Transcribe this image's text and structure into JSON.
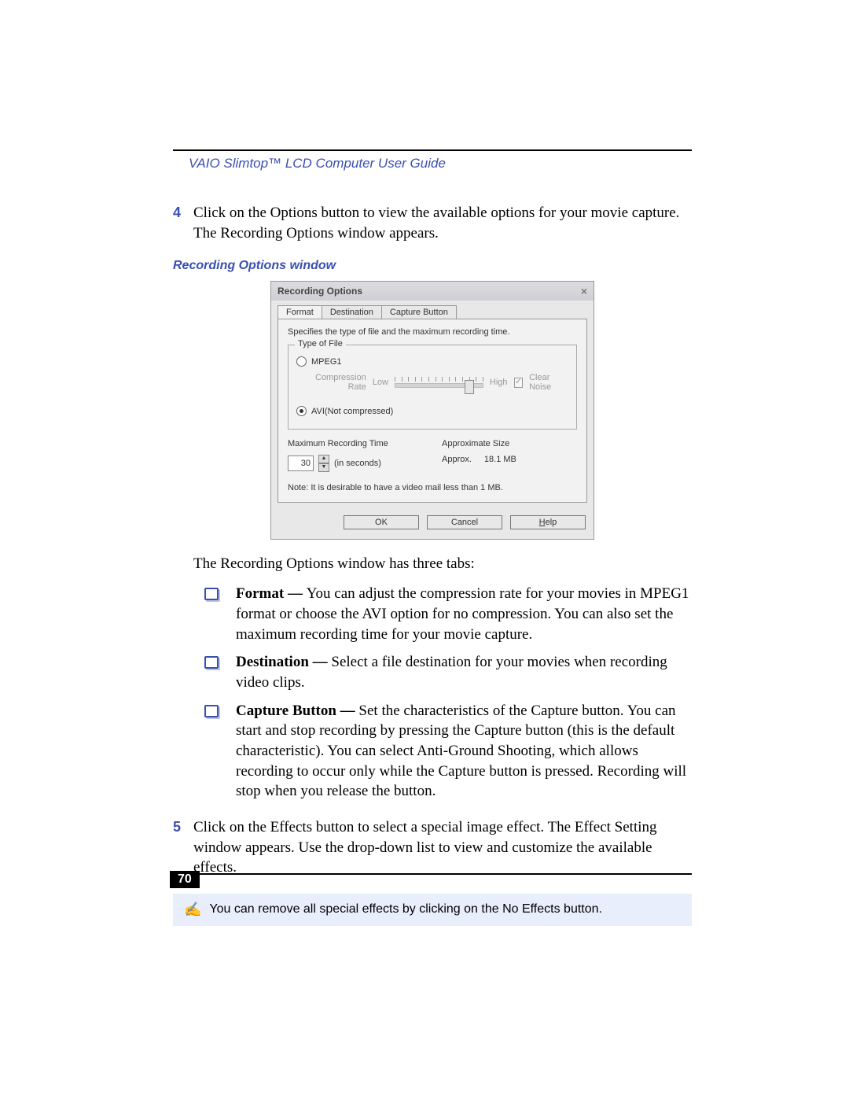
{
  "header": {
    "title": "VAIO Slimtop™ LCD Computer User Guide"
  },
  "step4": {
    "num": "4",
    "text": "Click on the Options button to view the available options for your movie capture. The Recording Options window appears."
  },
  "figure_caption": "Recording Options window",
  "dialog": {
    "title": "Recording Options",
    "tabs": {
      "format": "Format",
      "destination": "Destination",
      "capture": "Capture Button"
    },
    "spec_text": "Specifies the type of file and the maximum recording time.",
    "type_of_file": "Type of File",
    "mpeg1": "MPEG1",
    "compression_label_a": "Compression",
    "compression_label_b": "Rate",
    "low": "Low",
    "high": "High",
    "clear_noise": "Clear Noise",
    "avi": "AVI(Not compressed)",
    "max_rec_time": "Maximum Recording Time",
    "seconds_value": "30",
    "seconds_label": "(in seconds)",
    "approx_size_head": "Approximate Size",
    "approx_label": "Approx.",
    "approx_value": "18.1 MB",
    "note": "Note: It is desirable to have a video mail less than 1 MB.",
    "ok": "OK",
    "cancel": "Cancel",
    "help": "Help"
  },
  "tabs_intro": "The Recording Options window has three tabs:",
  "bullets": {
    "format_head": "Format — ",
    "format_body": "You can adjust the compression rate for your movies in MPEG1 format or choose the AVI option for no compression. You can also set the maximum recording time for your movie capture.",
    "dest_head": "Destination — ",
    "dest_body": "Select a file destination for your movies when recording video clips.",
    "cap_head": "Capture Button — ",
    "cap_body": "Set the characteristics of the Capture button. You can start and stop recording by pressing the Capture button (this is the default characteristic). You can select Anti-Ground Shooting, which allows recording to occur only while the Capture button is pressed. Recording will stop when you release the button."
  },
  "step5": {
    "num": "5",
    "text": "Click on the Effects button to select a special image effect. The Effect Setting window appears. Use the drop-down list to view and customize the available effects."
  },
  "tip": "You can remove all special effects by clicking on the No Effects button.",
  "page_number": "70"
}
